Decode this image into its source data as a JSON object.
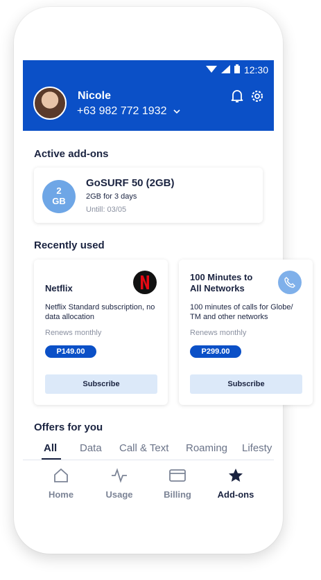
{
  "status": {
    "time": "12:30"
  },
  "profile": {
    "name": "Nicole",
    "phone": "+63 982 772 1932"
  },
  "active_addons": {
    "title": "Active add-ons",
    "item": {
      "badge_top": "2",
      "badge_bottom": "GB",
      "name": "GoSURF 50 (2GB)",
      "desc": "2GB for 3 days",
      "until": "Untill: 03/05"
    }
  },
  "recently_used": {
    "title": "Recently used",
    "cards": [
      {
        "title_line1": "Netflix",
        "title_line2": "",
        "icon": "netflix-logo",
        "desc": "Netflix Standard subscription, no data allocation",
        "renew": "Renews monthly",
        "price": "P149.00",
        "action": "Subscribe"
      },
      {
        "title_line1": "100 Minutes to",
        "title_line2": "All Networks",
        "icon": "phone-icon",
        "desc": "100 minutes of calls for Globe/ TM and other networks",
        "renew": "Renews monthly",
        "price": "P299.00",
        "action": "Subscribe"
      }
    ]
  },
  "offers": {
    "title": "Offers for you",
    "tabs": [
      "All",
      "Data",
      "Call & Text",
      "Roaming",
      "Lifesty"
    ]
  },
  "bottom_nav": [
    "Home",
    "Usage",
    "Billing",
    "Add-ons"
  ],
  "colors": {
    "primary": "#0b50c7",
    "text": "#1a2340",
    "muted": "#8a90a0",
    "badge": "#6ea6e6",
    "button_bg": "#dce9f9",
    "netflix_red": "#e50914"
  }
}
